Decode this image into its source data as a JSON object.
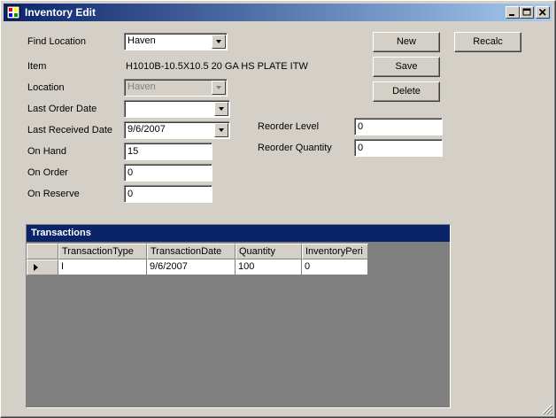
{
  "window": {
    "title": "Inventory Edit"
  },
  "form": {
    "find_location_label": "Find Location",
    "find_location_value": "Haven",
    "item_label": "Item",
    "item_value": "H1010B-10.5X10.5  20 GA HS PLATE ITW",
    "location_label": "Location",
    "location_value": "Haven",
    "last_order_date_label": "Last Order Date",
    "last_order_date_value": "",
    "last_received_date_label": "Last Received Date",
    "last_received_date_value": "9/6/2007",
    "on_hand_label": "On Hand",
    "on_hand_value": "15",
    "on_order_label": "On Order",
    "on_order_value": "0",
    "on_reserve_label": "On Reserve",
    "on_reserve_value": "0",
    "reorder_level_label": "Reorder Level",
    "reorder_level_value": "0",
    "reorder_quantity_label": "Reorder Quantity",
    "reorder_quantity_value": "0"
  },
  "buttons": {
    "new": "New",
    "save": "Save",
    "delete": "Delete",
    "recalc": "Recalc"
  },
  "grid": {
    "caption": "Transactions",
    "columns": [
      "TransactionType",
      "TransactionDate",
      "Quantity",
      "InventoryPeri"
    ],
    "rows": [
      [
        "I",
        "9/6/2007",
        "100",
        "0"
      ]
    ]
  },
  "colors": {
    "title_bar": "#0a246a",
    "face": "#d4d0c8",
    "grid_background": "#808080"
  }
}
